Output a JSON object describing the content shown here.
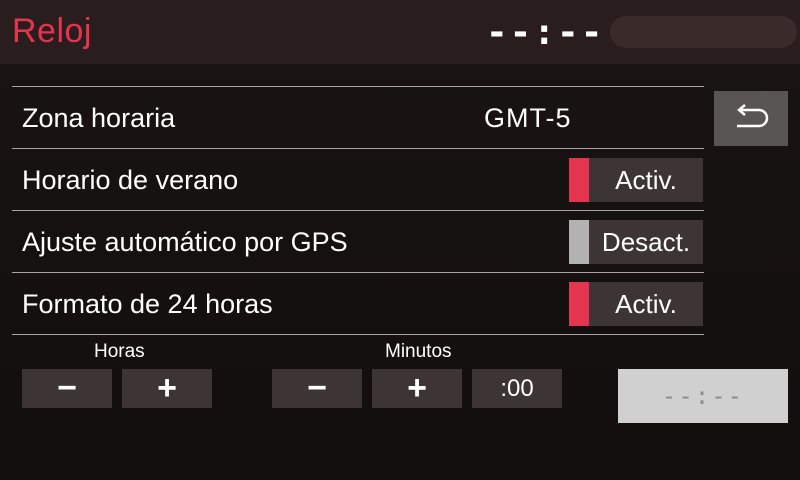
{
  "header": {
    "title": "Reloj",
    "clock": "--:--"
  },
  "settings": {
    "time_zone": {
      "label": "Zona horaria",
      "value": "GMT-5"
    },
    "daylight_saving": {
      "label": "Horario de verano",
      "state": "Activ.",
      "on": true
    },
    "gps_auto": {
      "label": "Ajuste automático por GPS",
      "state": "Desact.",
      "on": false
    },
    "format_24h": {
      "label": "Formato de 24 horas",
      "state": "Activ.",
      "on": true
    }
  },
  "adjust": {
    "hours_label": "Horas",
    "minutes_label": "Minutos",
    "minus": "−",
    "plus": "+",
    "reset_minutes": ":00",
    "set_time_display": "--:--"
  },
  "icons": {
    "back": "back-arrow-icon"
  },
  "colors": {
    "accent": "#e4344e",
    "toggle_off": "#b2b2b2",
    "button_bg": "#3d3535",
    "topbar_bg": "#2a1d1d"
  }
}
